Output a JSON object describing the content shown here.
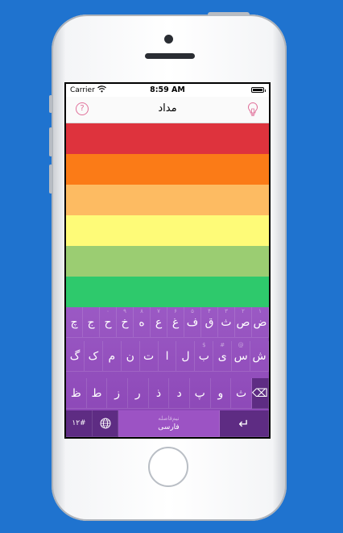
{
  "status_bar": {
    "carrier": "Carrier",
    "time": "8:59 AM"
  },
  "nav": {
    "title": "مداد",
    "help_glyph": "?",
    "help_icon": "question-circle-icon",
    "bulb_icon": "lightbulb-icon"
  },
  "colors": {
    "background": "#1f73cf",
    "accent": "#e0709a",
    "stripes": [
      "#de333d",
      "#fb7b17",
      "#fdbb62",
      "#fefb78",
      "#9bcd72",
      "#2ec96c"
    ],
    "keyboard": "#9b59c4",
    "keyboard_dark": "#5e2c83"
  },
  "keyboard": {
    "row1": [
      {
        "label": "ض",
        "hint": "۱"
      },
      {
        "label": "ص",
        "hint": "۲"
      },
      {
        "label": "ث",
        "hint": "۳"
      },
      {
        "label": "ق",
        "hint": "۴"
      },
      {
        "label": "ف",
        "hint": "۵"
      },
      {
        "label": "غ",
        "hint": "۶"
      },
      {
        "label": "ع",
        "hint": "۷"
      },
      {
        "label": "ه",
        "hint": "۸"
      },
      {
        "label": "خ",
        "hint": "۹"
      },
      {
        "label": "ح",
        "hint": "۰"
      },
      {
        "label": "ج",
        "hint": ""
      },
      {
        "label": "چ",
        "hint": ""
      }
    ],
    "row2": [
      {
        "label": "ش",
        "hint": ""
      },
      {
        "label": "س",
        "hint": "@"
      },
      {
        "label": "ی",
        "hint": "#"
      },
      {
        "label": "ب",
        "hint": "$"
      },
      {
        "label": "ل",
        "hint": ""
      },
      {
        "label": "ا",
        "hint": ""
      },
      {
        "label": "ت",
        "hint": ""
      },
      {
        "label": "ن",
        "hint": ""
      },
      {
        "label": "م",
        "hint": ""
      },
      {
        "label": "ک",
        "hint": ""
      },
      {
        "label": "گ",
        "hint": ""
      }
    ],
    "row3": [
      {
        "label": "ظ"
      },
      {
        "label": "ط"
      },
      {
        "label": "ز"
      },
      {
        "label": "ر"
      },
      {
        "label": "ذ"
      },
      {
        "label": "د"
      },
      {
        "label": "پ"
      },
      {
        "label": "و"
      },
      {
        "label": "ث"
      }
    ],
    "num_label": "۱۲#",
    "space_top": "نیم‌فاصله",
    "space_bottom": "فارسی",
    "enter_glyph": "↵",
    "backspace_glyph": "⌫",
    "globe_icon": "globe-icon"
  }
}
